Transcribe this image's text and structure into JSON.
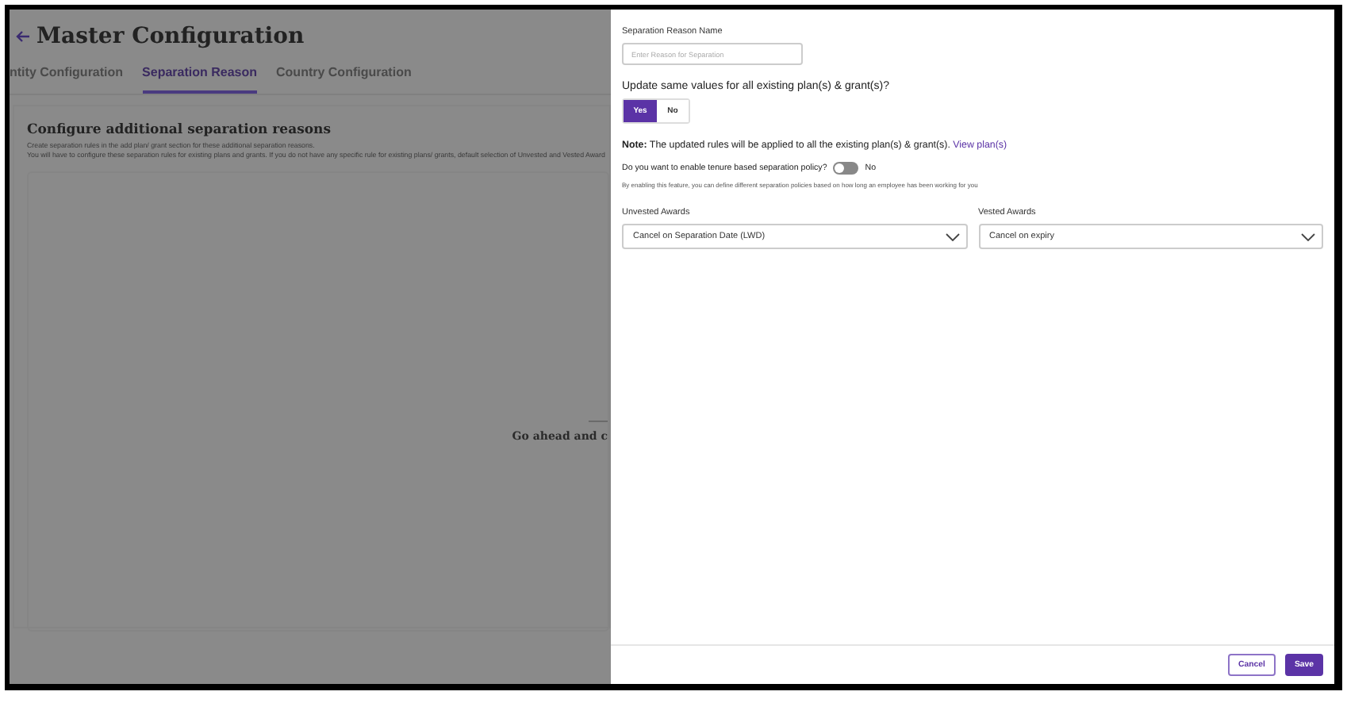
{
  "page": {
    "title": "Master Configuration",
    "tabs": [
      {
        "label": "ntity Configuration",
        "selected": false
      },
      {
        "label": "Separation Reason",
        "selected": true
      },
      {
        "label": "Country Configuration",
        "selected": false
      }
    ],
    "section": {
      "heading": "Configure additional separation reasons",
      "lines": [
        "Create separation rules in the add plan/ grant section for these additional separation reasons.",
        "You will have to configure these separation rules for existing plans and grants. If you do not have any specific rule for existing plans/ grants, default selection of Unvested and Vested Award"
      ]
    },
    "empty_state": {
      "message": "Go ahead and c"
    }
  },
  "drawer": {
    "name_field": {
      "label": "Separation Reason Name",
      "placeholder": "Enter Reason for Separation"
    },
    "update_question": "Update same values for all existing plan(s) & grant(s)?",
    "update_options": [
      {
        "label": "Yes",
        "selected": true
      },
      {
        "label": "No",
        "selected": false
      }
    ],
    "note": "**Note:** The updated rules will be applied to all the existing plan(s) & grant(s).",
    "note_link": "View plan(s)",
    "tenure": {
      "question": "Do you want to enable tenure based separation policy?",
      "on": false,
      "state_label": "No",
      "hint": "By enabling this feature, you can define different separation policies based on how long an employee has been working for you"
    },
    "awards": [
      {
        "label": "Unvested Awards",
        "value": "Cancel on Separation Date (LWD)"
      },
      {
        "label": "Vested Awards",
        "value": "Cancel on expiry"
      }
    ],
    "buttons": [
      {
        "label": "Cancel",
        "kind": "secondary"
      },
      {
        "label": "Save",
        "kind": "primary"
      }
    ]
  }
}
